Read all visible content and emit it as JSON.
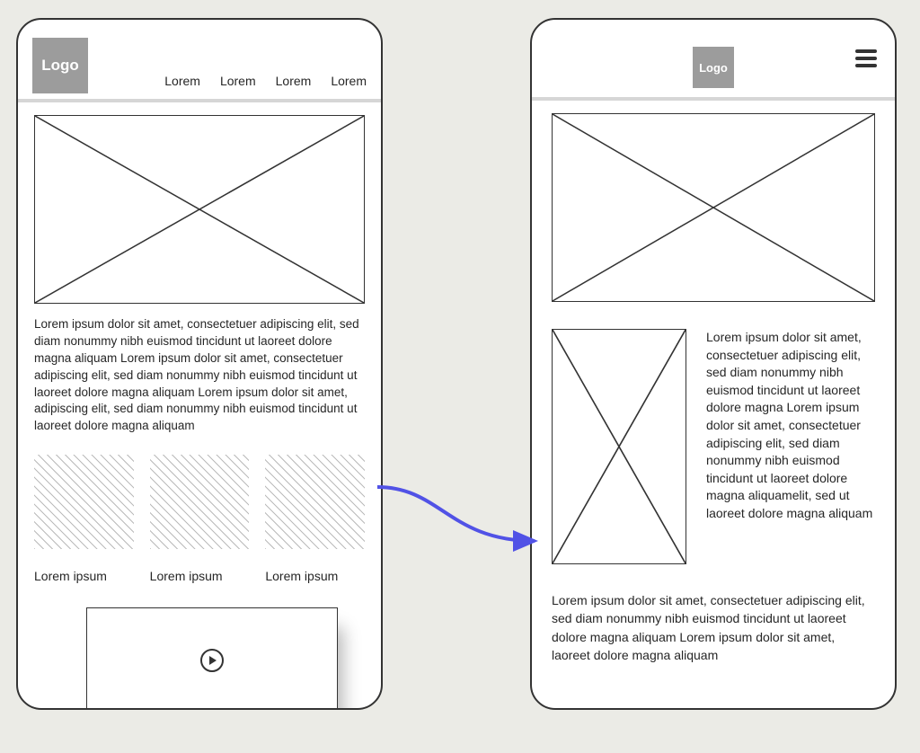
{
  "logo_text": "Logo",
  "deviceA": {
    "nav_items": [
      "Lorem",
      "Lorem",
      "Lorem",
      "Lorem"
    ],
    "paragraph": "Lorem ipsum dolor sit amet, consectetuer adipiscing elit, sed diam nonummy nibh euismod tincidunt ut laoreet dolore magna aliquam Lorem ipsum dolor sit amet, consectetuer adipiscing elit, sed diam nonummy nibh euismod tincidunt ut laoreet dolore magna aliquam Lorem ipsum dolor sit amet, adipiscing elit, sed diam nonummy nibh euismod tincidunt ut laoreet dolore magna aliquam",
    "thumbs": [
      "Lorem ipsum",
      "Lorem ipsum",
      "Lorem ipsum"
    ]
  },
  "deviceB": {
    "right_paragraph": "Lorem ipsum dolor sit amet, consectetuer adipiscing elit, sed diam nonummy nibh euismod tincidunt ut laoreet dolore magna Lorem ipsum dolor sit amet, consectetuer adipiscing elit, sed diam nonummy nibh euismod tincidunt ut laoreet dolore magna aliquamelit, sed ut laoreet dolore magna aliquam",
    "below_paragraph": "Lorem ipsum dolor sit amet, consectetuer adipiscing elit, sed diam nonummy nibh euismod tincidunt ut laoreet dolore magna aliquam Lorem ipsum dolor sit amet, laoreet dolore magna aliquam"
  }
}
